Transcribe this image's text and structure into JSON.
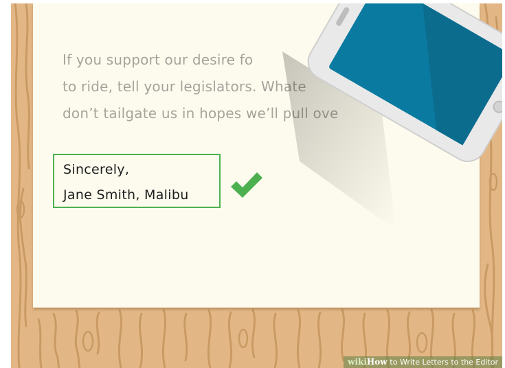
{
  "letter": {
    "line1": "If you support our desire fo",
    "line2": "to ride, tell your legislators. Whate",
    "line3": "don’t tailgate us in hopes we’ll pull ove"
  },
  "signature": {
    "line1": "Sincerely,",
    "line2": "Jane Smith, Malibu"
  },
  "watermark": {
    "brand": "wiki",
    "how": "How",
    "title": "to Write Letters to the Editor"
  },
  "colors": {
    "wood": "#e3b785",
    "paper": "#fdfbee",
    "highlight": "#4cb050",
    "phone_screen": "#0a7aa0",
    "phone_body": "#e9e9e9"
  },
  "icons": {
    "check": "check-icon",
    "phone": "smartphone-icon"
  }
}
